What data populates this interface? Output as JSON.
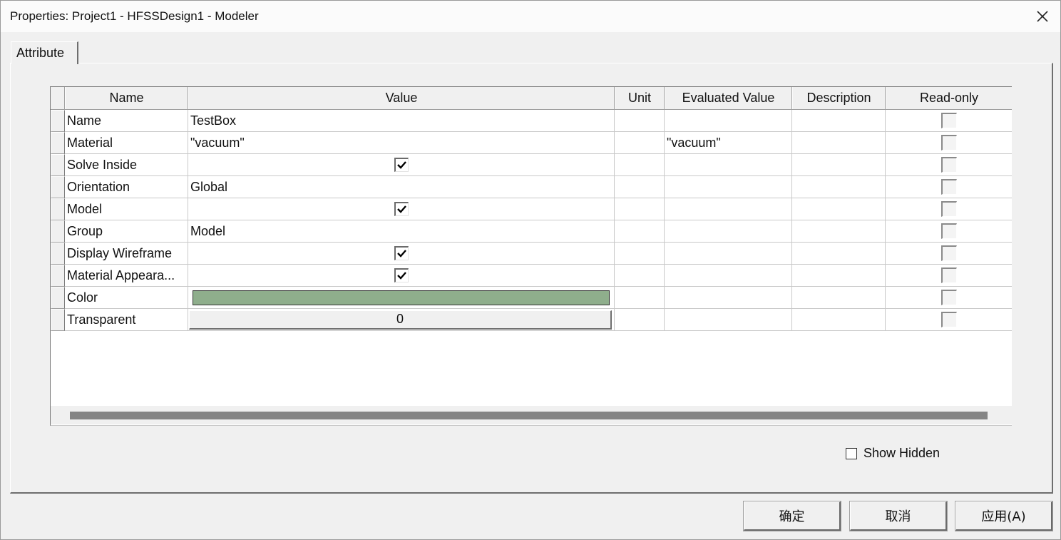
{
  "window": {
    "title": "Properties: Project1 - HFSSDesign1 - Modeler",
    "close_icon": "close-icon"
  },
  "tabs": [
    {
      "label": "Attribute",
      "active": true
    }
  ],
  "grid": {
    "columns": [
      "Name",
      "Value",
      "Unit",
      "Evaluated Value",
      "Description",
      "Read-only"
    ],
    "rows": [
      {
        "name": "Name",
        "value_type": "text",
        "value": "TestBox",
        "unit": "",
        "evaluated": "",
        "description": "",
        "read_only": false
      },
      {
        "name": "Material",
        "value_type": "text",
        "value": "\"vacuum\"",
        "unit": "",
        "evaluated": "\"vacuum\"",
        "description": "",
        "read_only": false
      },
      {
        "name": "Solve Inside",
        "value_type": "checkbox",
        "checked": true,
        "unit": "",
        "evaluated": "",
        "description": "",
        "read_only": false
      },
      {
        "name": "Orientation",
        "value_type": "text",
        "value": "Global",
        "unit": "",
        "evaluated": "",
        "description": "",
        "read_only": false
      },
      {
        "name": "Model",
        "value_type": "checkbox",
        "checked": true,
        "unit": "",
        "evaluated": "",
        "description": "",
        "read_only": false
      },
      {
        "name": "Group",
        "value_type": "text",
        "value": "Model",
        "unit": "",
        "evaluated": "",
        "description": "",
        "read_only": false
      },
      {
        "name": "Display Wireframe",
        "value_type": "checkbox",
        "checked": true,
        "unit": "",
        "evaluated": "",
        "description": "",
        "read_only": false
      },
      {
        "name": "Material Appeara...",
        "value_type": "checkbox",
        "checked": true,
        "unit": "",
        "evaluated": "",
        "description": "",
        "read_only": false
      },
      {
        "name": "Color",
        "value_type": "color",
        "color": "#8fae8c",
        "unit": "",
        "evaluated": "",
        "description": "",
        "read_only": false
      },
      {
        "name": "Transparent",
        "value_type": "slider",
        "value": "0",
        "unit": "",
        "evaluated": "",
        "description": "",
        "read_only": false
      }
    ]
  },
  "show_hidden": {
    "label": "Show Hidden",
    "checked": false
  },
  "buttons": {
    "ok": "确定",
    "cancel": "取消",
    "apply": "应用(A)"
  },
  "colors": {
    "accent_color_swatch": "#8fae8c",
    "dialog_bg": "#f0f0f0"
  }
}
